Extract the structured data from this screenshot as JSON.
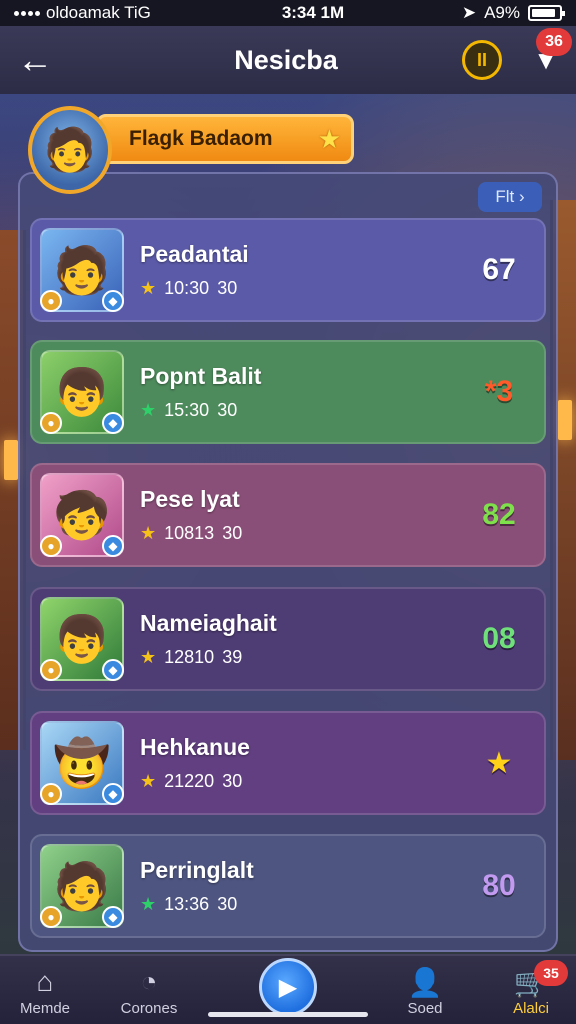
{
  "status_bar": {
    "carrier": "oldoamak TiG",
    "time": "3:34 1M",
    "battery": "A9%",
    "battery_level": 0.9
  },
  "header": {
    "title": "Nesicba",
    "notification_count": "36"
  },
  "player": {
    "name": "Flagk Badaom"
  },
  "filter": {
    "label": "Flt ›"
  },
  "items": [
    {
      "name": "Peadantai",
      "time": "10:30",
      "sub": "30",
      "score": "67",
      "bg": "#5b5aa8",
      "score_color": "#ffffff",
      "star_color": "#f5c21a"
    },
    {
      "name": "Popnt Balit",
      "time": "15:30",
      "sub": "30",
      "score": "*3",
      "bg": "#4d8a5c",
      "score_color": "#ff5a2a",
      "star_color": "#2ed06a"
    },
    {
      "name": "Pese lyat",
      "time": "10813",
      "sub": "30",
      "score": "82",
      "bg": "#8a4f78",
      "score_color": "#7ee04a",
      "star_color": "#f5c21a"
    },
    {
      "name": "Nameiaghait",
      "time": "12810",
      "sub": "39",
      "score": "08",
      "bg": "#4e3c74",
      "score_color": "#6fe07a",
      "star_color": "#f5c21a"
    },
    {
      "name": "Hehkanue",
      "time": "21220",
      "sub": "30",
      "score": "★",
      "bg": "#613f80",
      "score_color": "#ffd21a",
      "star_color": "#f5c21a"
    },
    {
      "name": "Perringlalt",
      "time": "13:36",
      "sub": "30",
      "score": "80",
      "bg": "#4e5580",
      "score_color": "#c29af0",
      "star_color": "#2ed06a"
    }
  ],
  "nav": {
    "items": [
      {
        "label": "Memde",
        "icon": "home-icon"
      },
      {
        "label": "Corones",
        "icon": "clock-icon"
      },
      {
        "label": "",
        "icon": "play-icon"
      },
      {
        "label": "Soed",
        "icon": "profile-icon"
      },
      {
        "label": "Alalci",
        "icon": "cart-icon"
      }
    ],
    "badge": "35"
  }
}
